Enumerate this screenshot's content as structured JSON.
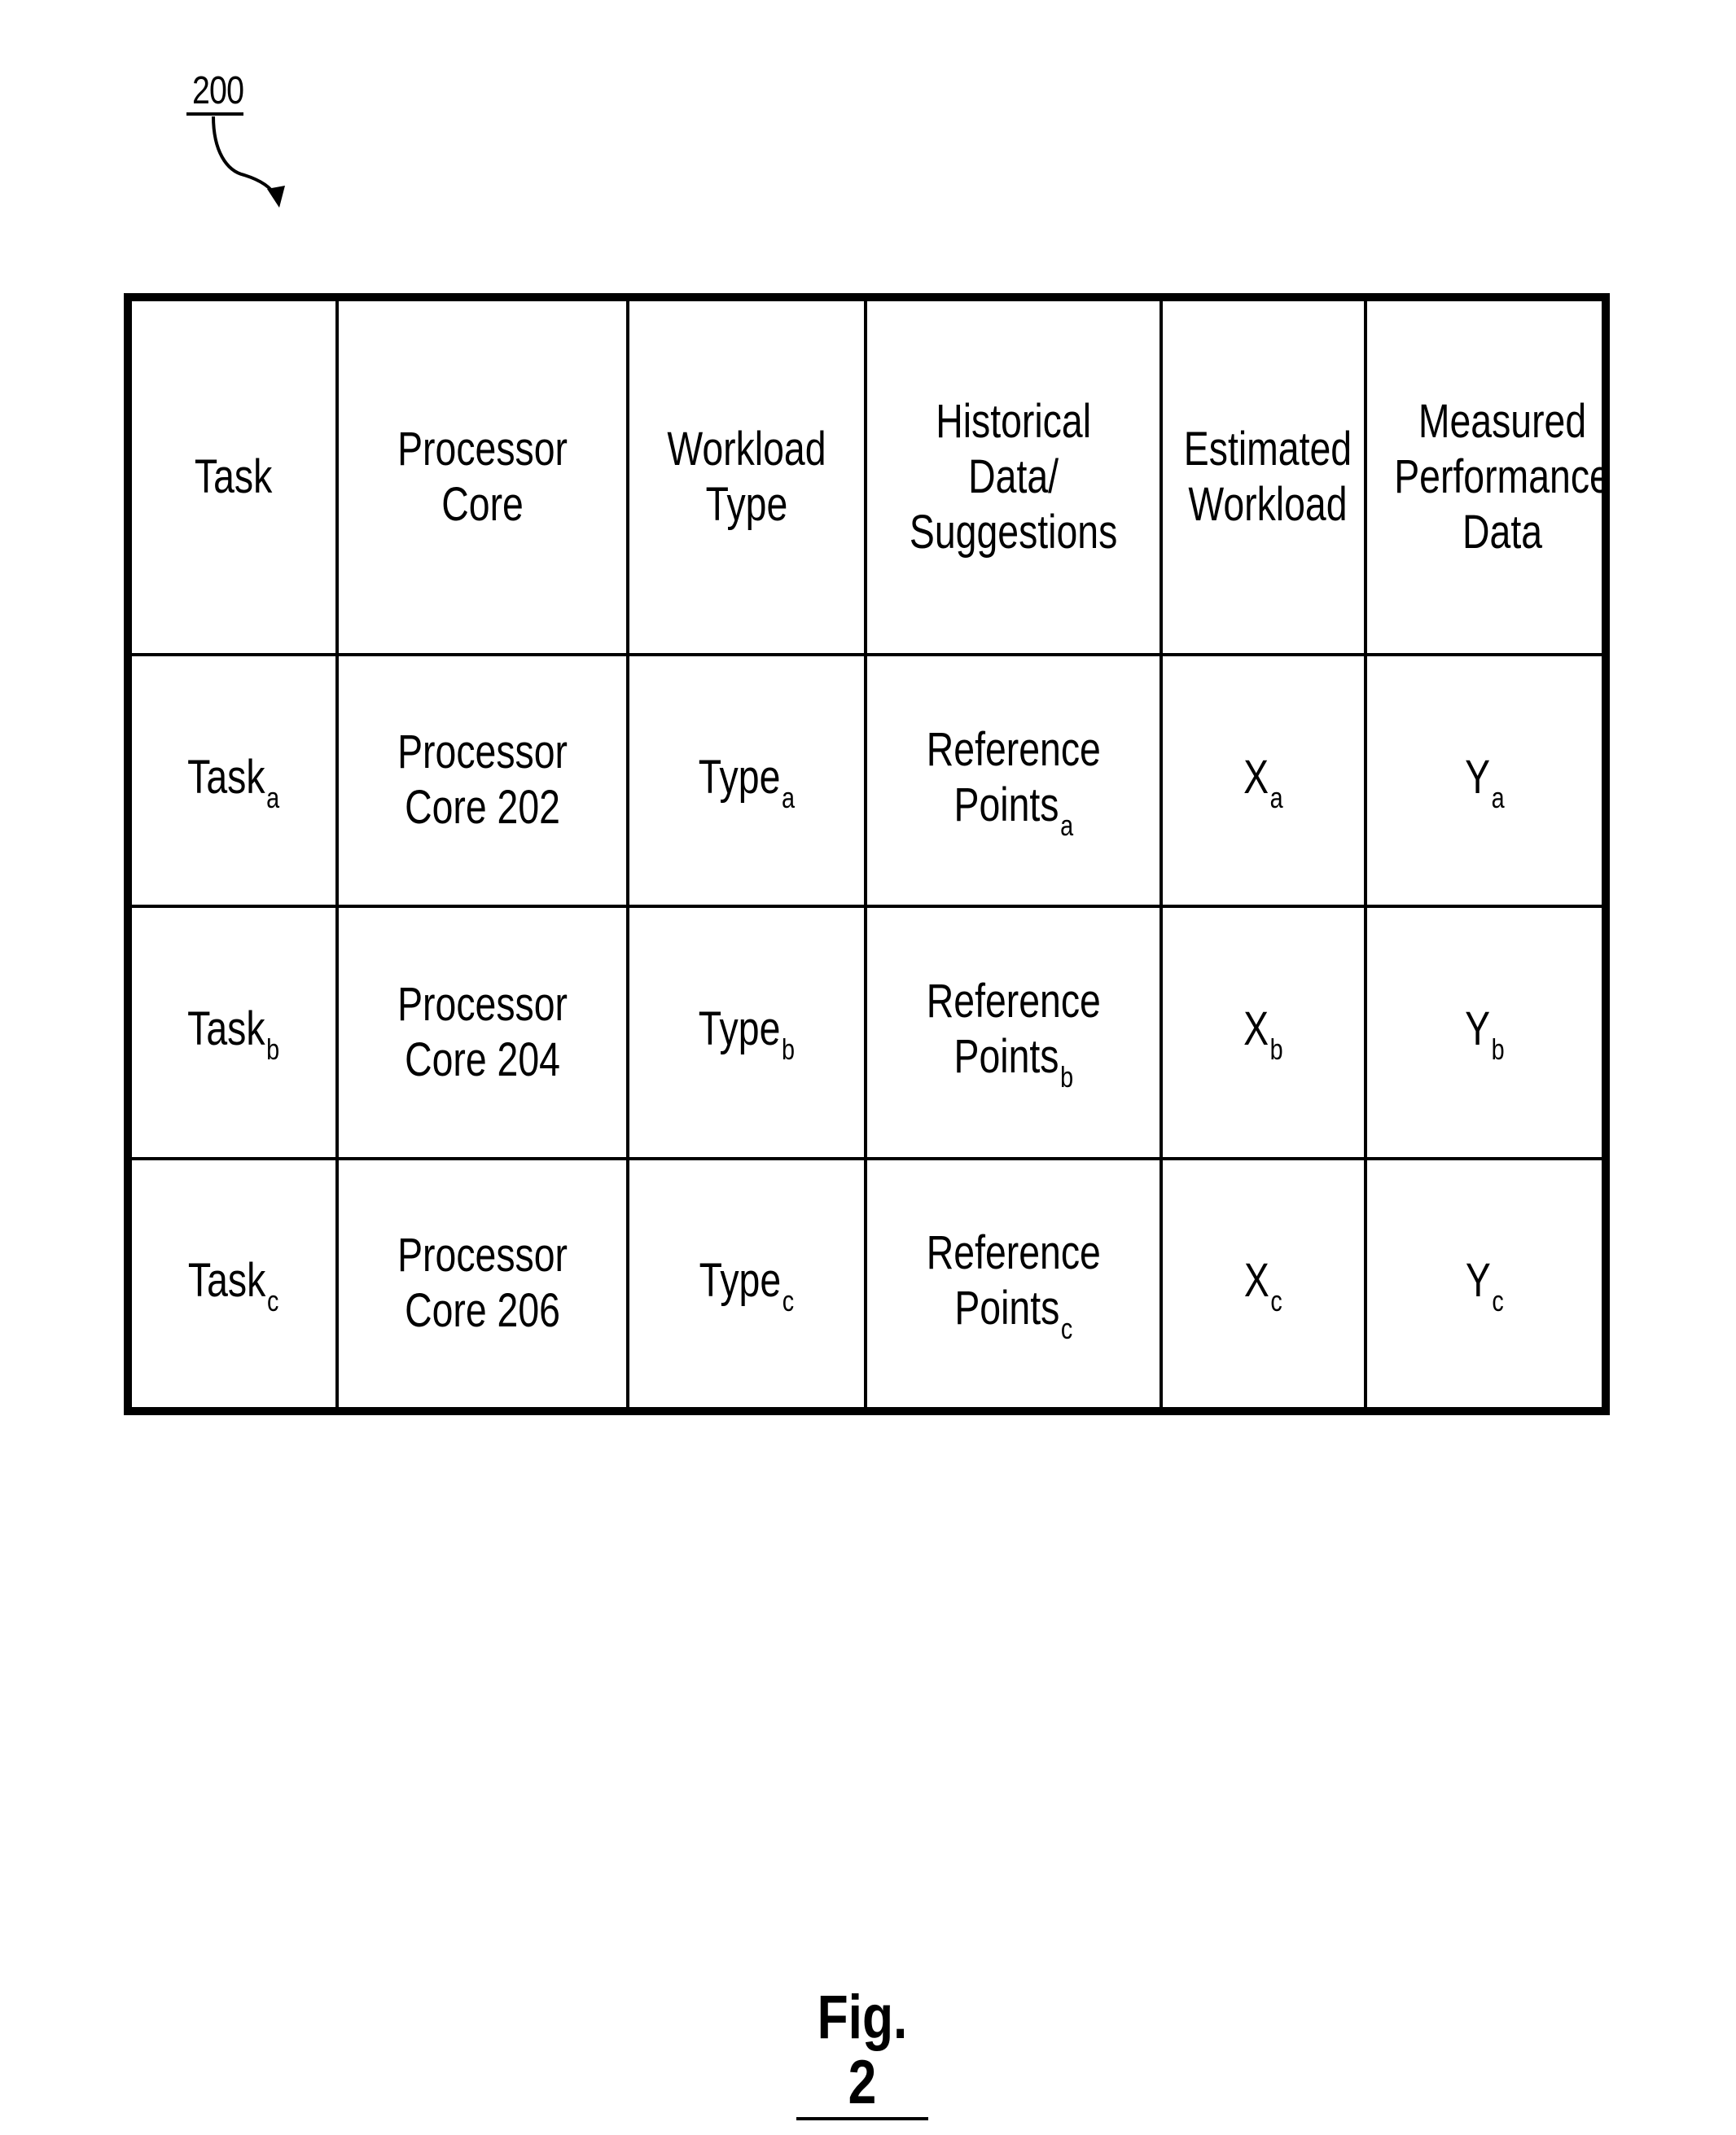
{
  "figure": {
    "reference_numeral": "200",
    "caption": "Fig. 2"
  },
  "table": {
    "headers": [
      "Task",
      "Processor\nCore",
      "Workload\nType",
      "Historical\nData/\nSuggestions",
      "Estimated\nWorkload",
      "Measured\nPerformance\nData"
    ],
    "rows": [
      {
        "task": {
          "text": "Task",
          "sub": "a"
        },
        "processor_core": {
          "text": "Processor\nCore 202",
          "sub": ""
        },
        "workload_type": {
          "text": "Type",
          "sub": "a"
        },
        "historical": {
          "text": "Reference\nPoints",
          "sub": "a"
        },
        "estimated_workload": {
          "text": "X",
          "sub": "a"
        },
        "measured_performance": {
          "text": "Y",
          "sub": "a"
        }
      },
      {
        "task": {
          "text": "Task",
          "sub": "b"
        },
        "processor_core": {
          "text": "Processor\nCore 204",
          "sub": ""
        },
        "workload_type": {
          "text": "Type",
          "sub": "b"
        },
        "historical": {
          "text": "Reference\nPoints",
          "sub": "b"
        },
        "estimated_workload": {
          "text": "X",
          "sub": "b"
        },
        "measured_performance": {
          "text": "Y",
          "sub": "b"
        }
      },
      {
        "task": {
          "text": "Task",
          "sub": "c"
        },
        "processor_core": {
          "text": "Processor\nCore 206",
          "sub": ""
        },
        "workload_type": {
          "text": "Type",
          "sub": "c"
        },
        "historical": {
          "text": "Reference\nPoints",
          "sub": "c"
        },
        "estimated_workload": {
          "text": "X",
          "sub": "c"
        },
        "measured_performance": {
          "text": "Y",
          "sub": "c"
        }
      }
    ]
  }
}
